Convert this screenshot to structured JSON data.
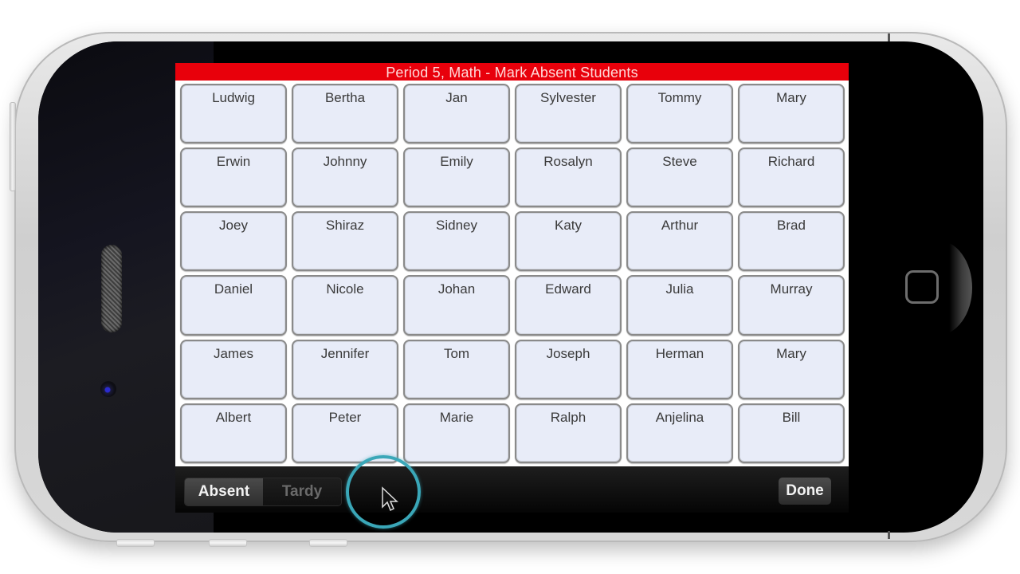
{
  "header": {
    "title": "Period 5, Math - Mark Absent Students"
  },
  "students": [
    [
      "Ludwig",
      "Bertha",
      "Jan",
      "Sylvester",
      "Tommy",
      "Mary"
    ],
    [
      "Erwin",
      "Johnny",
      "Emily",
      "Rosalyn",
      "Steve",
      "Richard"
    ],
    [
      "Joey",
      "Shiraz",
      "Sidney",
      "Katy",
      "Arthur",
      "Brad"
    ],
    [
      "Daniel",
      "Nicole",
      "Johan",
      "Edward",
      "Julia",
      "Murray"
    ],
    [
      "James",
      "Jennifer",
      "Tom",
      "Joseph",
      "Herman",
      "Mary"
    ],
    [
      "Albert",
      "Peter",
      "Marie",
      "Ralph",
      "Anjelina",
      "Bill"
    ]
  ],
  "toolbar": {
    "segments": [
      {
        "label": "Absent",
        "selected": true
      },
      {
        "label": "Tardy",
        "selected": false
      }
    ],
    "done_label": "Done"
  },
  "colors": {
    "header_red": "#e8000b",
    "cell_fill": "#e8ecf8",
    "click_ring": "#3aa7b8"
  },
  "device": {
    "icons": [
      "speaker-icon",
      "camera-icon",
      "home-button-icon",
      "cursor-icon"
    ]
  }
}
